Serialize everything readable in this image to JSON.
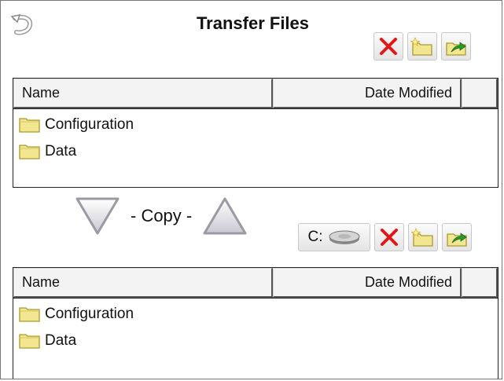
{
  "window": {
    "title": "Transfer Files"
  },
  "icons": {
    "back": "back-arrow-icon",
    "delete": "red-x-icon",
    "new_folder": "new-folder-icon",
    "up_folder": "up-folder-icon",
    "drive": "hard-drive-icon",
    "folder": "folder-icon"
  },
  "colors": {
    "delete": "#e01818",
    "folder": "#f2e690",
    "up_arrow": "#2a9a2a"
  },
  "top_panel": {
    "columns": [
      "Name",
      "Date Modified"
    ],
    "items": [
      {
        "name": "Configuration"
      },
      {
        "name": "Data"
      }
    ]
  },
  "copy": {
    "label": "- Copy -",
    "down_icon": "copy-down-icon",
    "up_icon": "copy-up-icon"
  },
  "bottom_toolbar": {
    "drive_label": "C:"
  },
  "bottom_panel": {
    "columns": [
      "Name",
      "Date Modified"
    ],
    "items": [
      {
        "name": "Configuration"
      },
      {
        "name": "Data"
      }
    ]
  }
}
